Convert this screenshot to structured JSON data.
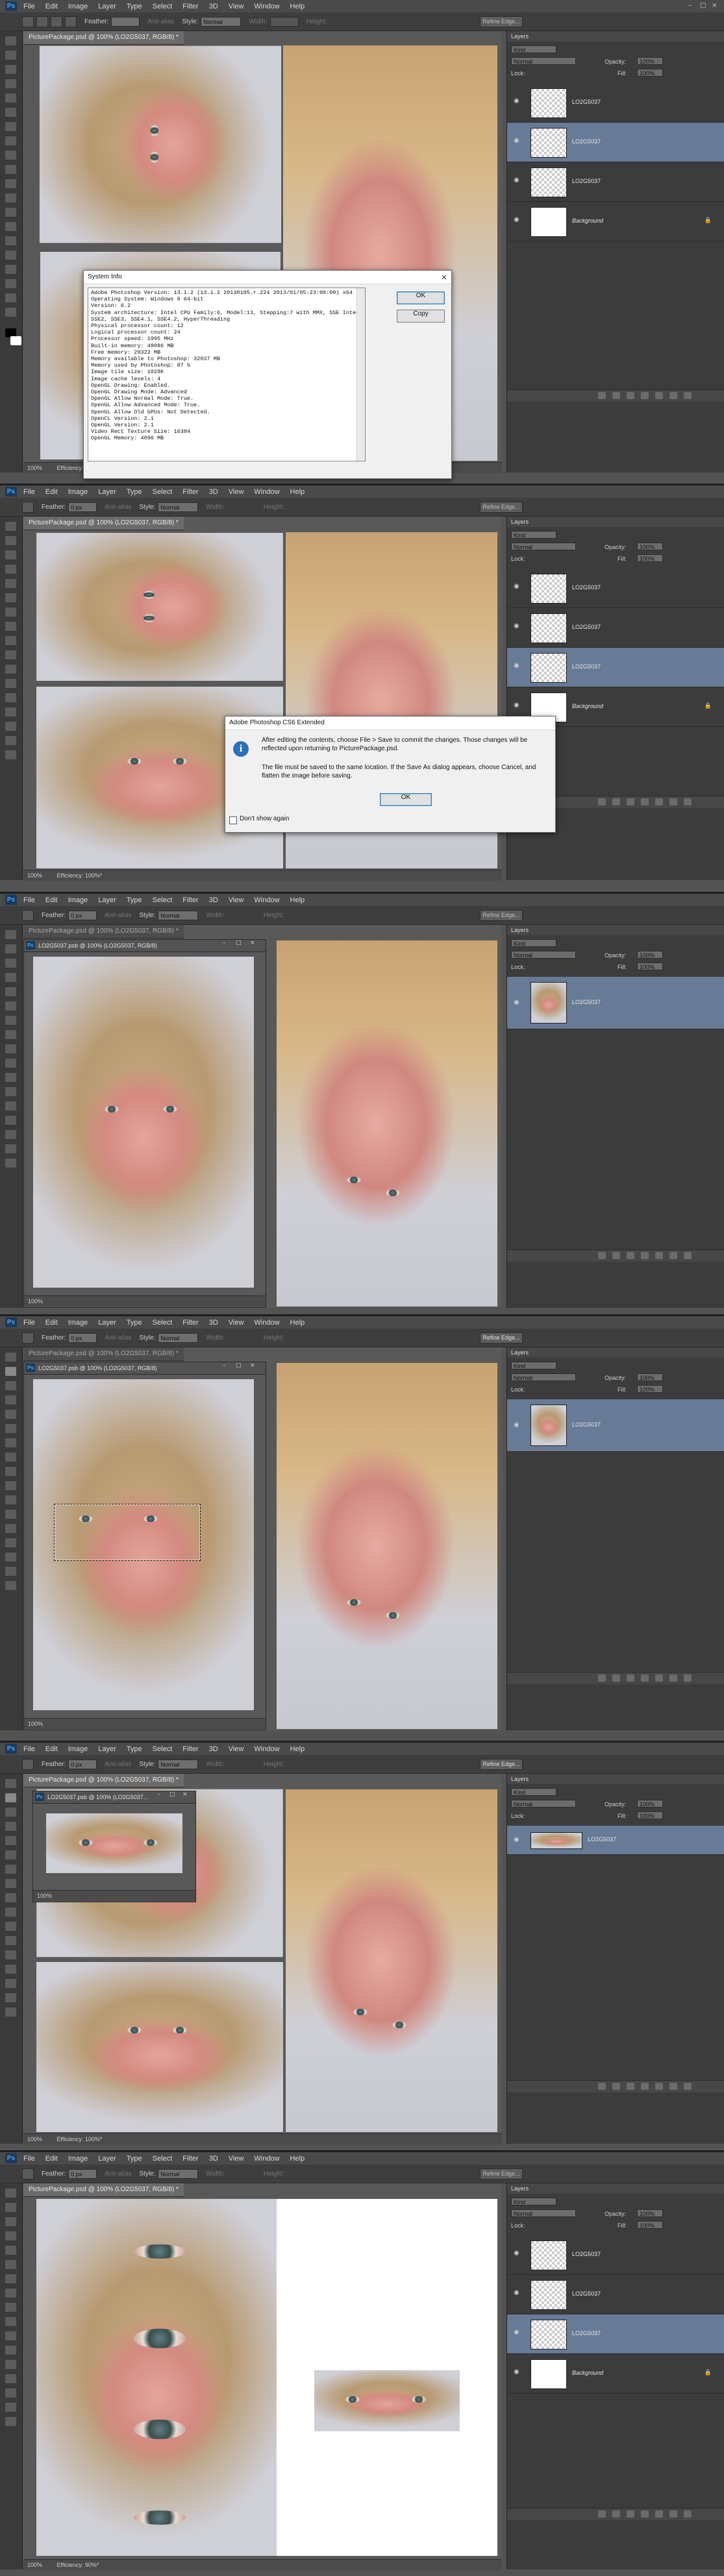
{
  "app": {
    "logo": "Ps",
    "menu": [
      "File",
      "Edit",
      "Image",
      "Layer",
      "Type",
      "Select",
      "Filter",
      "3D",
      "View",
      "Window",
      "Help"
    ],
    "window_controls": [
      "–",
      "□",
      "×"
    ]
  },
  "options_bar": {
    "feather_label": "Feather:",
    "feather_value": "0 px",
    "antialias_label": "Anti-alias",
    "style_label": "Style:",
    "style_value": "Normal",
    "width_label": "Width:",
    "height_label": "Height:",
    "refine_label": "Refine Edge..."
  },
  "docs": {
    "package": "PicturePackage.psd @ 100% (LO2G5037, RGB/8) *",
    "lo_doc": "LO2G5037.psb @ 100% (LO2G5037, RGB/8)",
    "lo_doc_short": "LO2G5037.psb @ 100% (LO2G5037..."
  },
  "status": {
    "zoom": "100%",
    "efficiency": "Efficiency: 100%*",
    "efficiency_90": "Efficiency: 90%*"
  },
  "layers_panel": {
    "title": "Layers",
    "kind_label": "Kind",
    "blend_mode": "Normal",
    "opacity_label": "Opacity:",
    "opacity_value": "100%",
    "lock_label": "Lock:",
    "fill_label": "Fill:",
    "fill_value": "100%",
    "layer_name": "LO2G5037",
    "background_name": "Background",
    "eye_glyph": "◉",
    "lock_glyph": "🔒"
  },
  "system_info": {
    "title": "System Info",
    "ok_label": "OK",
    "copy_label": "Copy",
    "lines": [
      "Adobe Photoshop Version: 13.1.2 (13.1.2 20130105.r.224 2013/01/05:23:00:00) x64",
      "Operating System: Windows 8 64-bit",
      "Version: 6.2",
      "System architecture: Intel CPU Family:6, Model:13, Stepping:7 with MMX, SSE Integer, SSE FP,",
      "SSE2, SSE3, SSE4.1, SSE4.2, HyperThreading",
      "Physical processor count: 12",
      "Logical processor count: 24",
      "Processor speed: 1995 MHz",
      "Built-in memory: 49086 MB",
      "Free memory: 29322 MB",
      "Memory available to Photoshop: 32037 MB",
      "Memory used by Photoshop: 87 %",
      "Image tile size: 1028K",
      "Image cache levels: 4",
      "OpenGL Drawing: Enabled.",
      "OpenGL Drawing Mode: Advanced",
      "OpenGL Allow Normal Mode: True.",
      "OpenGL Allow Advanced Mode: True.",
      "OpenGL Allow Old GPUs: Not Detected.",
      "OpenCL Version: 2.1",
      "OpenGL Version: 2.1",
      "Video Rect Texture Size: 16384",
      "OpenGL Memory: 4096 MB"
    ]
  },
  "smart_object_dialog": {
    "title": "Adobe Photoshop CS6 Extended",
    "message_1": "After editing the contents, choose File > Save to commit the changes.  Those changes will be reflected upon returning to PicturePackage.psd.",
    "message_2": "The file must be saved to the same location. If the Save As dialog appears, choose Cancel, and flatten the image before saving.",
    "ok_label": "OK",
    "dont_show_label": "Don't show again"
  }
}
